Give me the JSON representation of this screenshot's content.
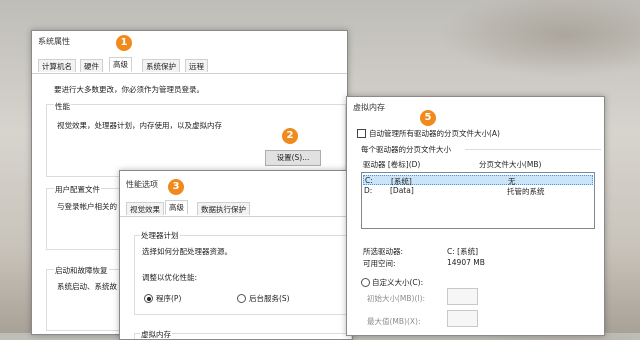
{
  "sys_props": {
    "title": "系统属性",
    "tabs": [
      "计算机名",
      "硬件",
      "高级",
      "系统保护",
      "远程"
    ],
    "admin_note": "要进行大多数更改，你必须作为管理员登录。",
    "perf_group": "性能",
    "perf_desc": "视觉效果，处理器计划，内存使用，以及虚拟内存",
    "settings_button": "设置(S)...",
    "user_profile_group": "用户配置文件",
    "user_profile_desc": "与登录帐户相关的",
    "startup_group": "启动和故障恢复",
    "startup_desc": "系统启动、系统故"
  },
  "perf_options": {
    "title": "性能选项",
    "tabs": [
      "视觉效果",
      "高级",
      "数据执行保护"
    ],
    "cpu_group": "处理器计划",
    "cpu_desc": "选择如何分配处理器资源。",
    "optimize_label": "调整以优化性能:",
    "radio_programs": "程序(P)",
    "radio_background": "后台服务(S)",
    "vm_group": "虚拟内存"
  },
  "virtual_memory": {
    "title": "虚拟内存",
    "auto_manage": "自动管理所有驱动器的分页文件大小(A)",
    "per_drive": "每个驱动器的分页文件大小",
    "col_drive": "驱动器 [卷标](D)",
    "col_size": "分页文件大小(MB)",
    "drives": [
      {
        "drive": "C:",
        "label": "[系统]",
        "size": "无"
      },
      {
        "drive": "D:",
        "label": "[Data]",
        "size": "托管的系统"
      }
    ],
    "selected_drive_label": "所选驱动器:",
    "selected_drive_value": "C:  [系统]",
    "free_space_label": "可用空间:",
    "free_space_value": "14907 MB",
    "custom_size": "自定义大小(C):",
    "initial_size": "初始大小(MB)(I):",
    "max_size": "最大值(MB)(X):"
  },
  "badges": [
    "1",
    "2",
    "3",
    "5"
  ],
  "colors": {
    "badge": "#f08a1c",
    "selection": "#cce4f7"
  }
}
